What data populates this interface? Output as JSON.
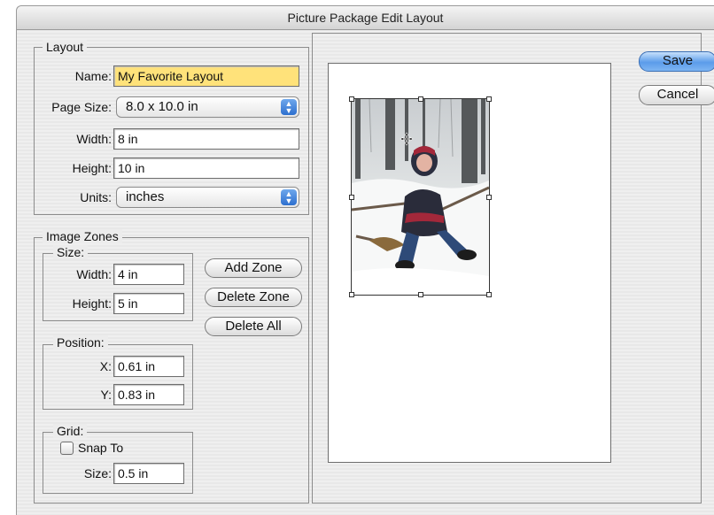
{
  "window": {
    "title": "Picture Package Edit Layout"
  },
  "layout": {
    "legend": "Layout",
    "name_label": "Name:",
    "name_value": "My Favorite Layout",
    "page_size_label": "Page Size:",
    "page_size_value": "8.0 x 10.0 in",
    "width_label": "Width:",
    "width_value": "8 in",
    "height_label": "Height:",
    "height_value": "10 in",
    "units_label": "Units:",
    "units_value": "inches"
  },
  "image_zones": {
    "legend": "Image Zones",
    "size": {
      "legend": "Size:",
      "width_label": "Width:",
      "width_value": "4 in",
      "height_label": "Height:",
      "height_value": "5 in"
    },
    "position": {
      "legend": "Position:",
      "x_label": "X:",
      "x_value": "0.61 in",
      "y_label": "Y:",
      "y_value": "0.83 in"
    },
    "grid": {
      "legend": "Grid:",
      "snap_label": "Snap To",
      "snap_checked": false,
      "size_label": "Size:",
      "size_value": "0.5 in"
    },
    "buttons": {
      "add": "Add Zone",
      "delete": "Delete Zone",
      "delete_all": "Delete All"
    }
  },
  "dialog_buttons": {
    "save": "Save",
    "cancel": "Cancel"
  },
  "icons": {
    "popup_arrows": "updown-arrows-icon",
    "move_cursor": "move-cursor-icon"
  },
  "colors": {
    "name_highlight": "#ffe27a",
    "default_button": "#5b9cea"
  }
}
